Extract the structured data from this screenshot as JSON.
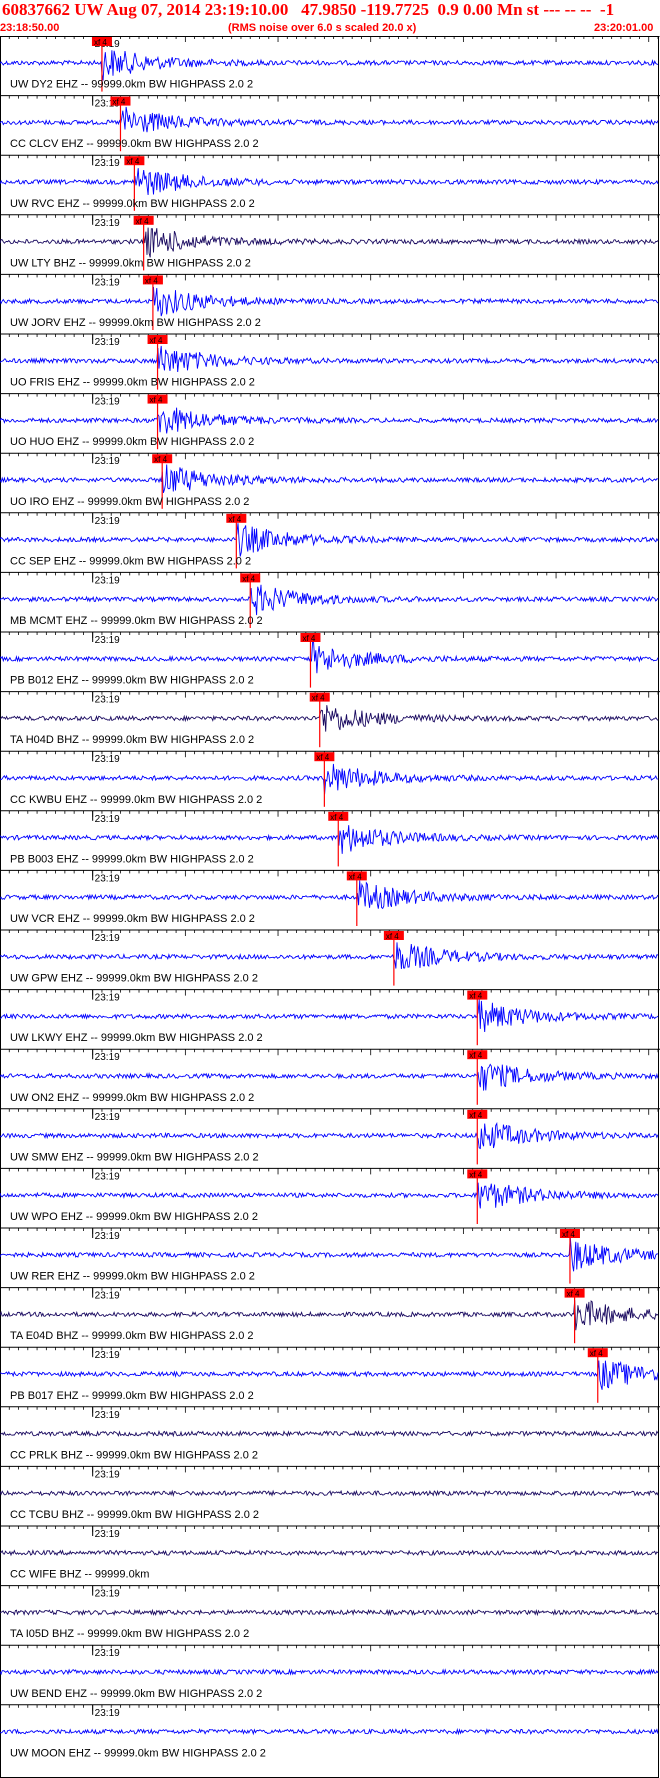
{
  "header": {
    "title": "60837662 UW Aug 07, 2014 23:19:10.00   47.9850 -119.7725  0.9 0.00 Mn st --- -- --  -1",
    "start_time": "23:18:50.00",
    "noise_note": "(RMS noise over 6.0 s scaled 20.0 x)",
    "end_time": "23:20:01.00"
  },
  "colors": {
    "trace_blue": "#0000ff",
    "trace_dark": "#1a0a60",
    "pick_red": "#ff0000",
    "header_red": "#ff0000",
    "grid": "#000000"
  },
  "chart_data": {
    "type": "line",
    "title": "60837662 UW Aug 07, 2014 23:19:10.00   47.9850 -119.7725  0.9 0.00 Mn st --- -- --  -1",
    "x_range": [
      "23:18:50.00",
      "23:20:01.00"
    ],
    "minute_label": "23:19",
    "pick_label": "xf 4",
    "series": [
      {
        "name": "UW DY2 EHZ -- 99999.0km BW  HIGHPASS  2.0  2",
        "pick_s": 11.0,
        "color": "blue"
      },
      {
        "name": "CC CLCV EHZ -- 99999.0km BW  HIGHPASS  2.0  2",
        "pick_s": 13.0,
        "color": "blue"
      },
      {
        "name": "UW RVC EHZ -- 99999.0km BW  HIGHPASS  2.0  2",
        "pick_s": 14.5,
        "color": "blue"
      },
      {
        "name": "UW LTY BHZ -- 99999.0km BW  HIGHPASS  2.0  2",
        "pick_s": 15.5,
        "color": "dark"
      },
      {
        "name": "UW JORV EHZ -- 99999.0km BW  HIGHPASS  2.0  2",
        "pick_s": 16.5,
        "color": "blue"
      },
      {
        "name": "UO FRIS EHZ -- 99999.0km BW  HIGHPASS  2.0  2",
        "pick_s": 17.0,
        "color": "blue"
      },
      {
        "name": "UO HUO EHZ -- 99999.0km BW  HIGHPASS  2.0  2",
        "pick_s": 17.0,
        "color": "blue"
      },
      {
        "name": "UO IRO EHZ -- 99999.0km BW  HIGHPASS  2.0  2",
        "pick_s": 17.5,
        "color": "blue"
      },
      {
        "name": "CC SEP EHZ -- 99999.0km BW  HIGHPASS  2.0  2",
        "pick_s": 25.5,
        "color": "blue"
      },
      {
        "name": "MB MCMT EHZ -- 99999.0km BW  HIGHPASS  2.0  2",
        "pick_s": 27.0,
        "color": "blue"
      },
      {
        "name": "PB B012 EHZ -- 99999.0km BW  HIGHPASS  2.0  2",
        "pick_s": 33.5,
        "color": "blue"
      },
      {
        "name": "TA H04D BHZ -- 99999.0km BW  HIGHPASS  2.0  2",
        "pick_s": 34.5,
        "color": "dark"
      },
      {
        "name": "CC KWBU EHZ -- 99999.0km BW  HIGHPASS  2.0  2",
        "pick_s": 35.0,
        "color": "blue"
      },
      {
        "name": "PB B003 EHZ -- 99999.0km BW  HIGHPASS  2.0  2",
        "pick_s": 36.5,
        "color": "blue"
      },
      {
        "name": "UW VCR EHZ -- 99999.0km BW  HIGHPASS  2.0  2",
        "pick_s": 38.5,
        "color": "blue"
      },
      {
        "name": "UW GPW EHZ -- 99999.0km BW  HIGHPASS  2.0  2",
        "pick_s": 42.5,
        "color": "blue"
      },
      {
        "name": "UW LKWY EHZ -- 99999.0km BW  HIGHPASS  2.0  2",
        "pick_s": 51.5,
        "color": "blue"
      },
      {
        "name": "UW ON2 EHZ -- 99999.0km BW  HIGHPASS  2.0  2",
        "pick_s": 51.5,
        "color": "blue"
      },
      {
        "name": "UW SMW EHZ -- 99999.0km BW  HIGHPASS  2.0  2",
        "pick_s": 51.5,
        "color": "blue"
      },
      {
        "name": "UW WPO EHZ -- 99999.0km BW  HIGHPASS  2.0  2",
        "pick_s": 51.5,
        "color": "blue"
      },
      {
        "name": "UW RER EHZ -- 99999.0km BW  HIGHPASS  2.0  2",
        "pick_s": 61.5,
        "color": "blue"
      },
      {
        "name": "TA E04D BHZ -- 99999.0km BW  HIGHPASS  2.0  2",
        "pick_s": 62.0,
        "color": "dark"
      },
      {
        "name": "PB B017 EHZ -- 99999.0km BW  HIGHPASS  2.0  2",
        "pick_s": 64.5,
        "color": "blue"
      },
      {
        "name": "CC PRLK BHZ -- 99999.0km BW  HIGHPASS  2.0  2",
        "pick_s": null,
        "color": "dark"
      },
      {
        "name": "CC TCBU BHZ -- 99999.0km BW  HIGHPASS  2.0  2",
        "pick_s": null,
        "color": "dark"
      },
      {
        "name": "CC WIFE BHZ -- 99999.0km",
        "pick_s": null,
        "color": "dark"
      },
      {
        "name": "TA I05D BHZ -- 99999.0km BW  HIGHPASS  2.0  2",
        "pick_s": null,
        "color": "dark"
      },
      {
        "name": "UW BEND EHZ -- 99999.0km BW  HIGHPASS  2.0  2",
        "pick_s": null,
        "color": "blue"
      },
      {
        "name": "UW MOON EHZ -- 99999.0km BW  HIGHPASS  2.0  2",
        "pick_s": null,
        "color": "blue"
      }
    ]
  }
}
